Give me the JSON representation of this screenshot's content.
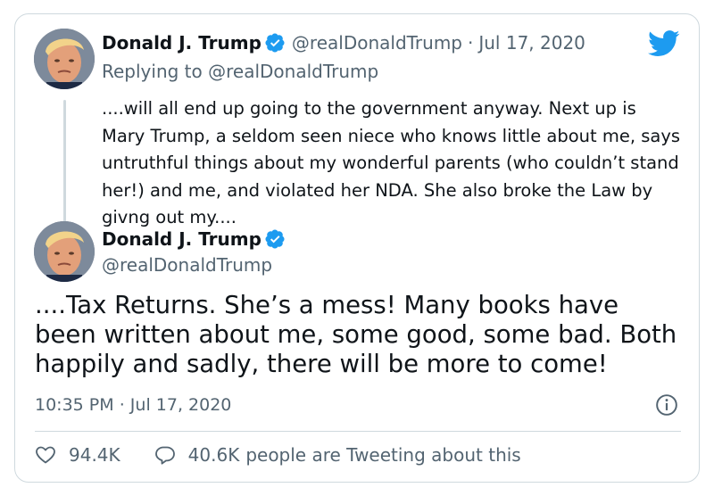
{
  "colors": {
    "brand": "#1d9bf0",
    "text_primary": "#0f1419",
    "text_secondary": "#536471",
    "border": "#cfd9de"
  },
  "parent_tweet": {
    "author_name": "Donald J. Trump",
    "verified_icon": "verified-badge-icon",
    "handle": "@realDonaldTrump",
    "separator": "·",
    "date": "Jul 17, 2020",
    "replying_to_prefix": "Replying to",
    "replying_to_handle": "@realDonaldTrump",
    "text": "....will all end up going to the government anyway. Next up is Mary Trump, a seldom seen niece who knows little about me, says untruthful things about my wonderful parents (who couldn’t stand her!) and me, and violated her NDA. She also broke the Law by givng out my...."
  },
  "main_tweet": {
    "author_name": "Donald J. Trump",
    "verified_icon": "verified-badge-icon",
    "handle": "@realDonaldTrump",
    "text": "....Tax Returns. She’s a mess! Many books have been written about me, some good, some bad. Both happily and sadly, there will be more to come!",
    "time": "10:35 PM",
    "separator": "·",
    "date": "Jul 17, 2020",
    "info_icon": "info-icon"
  },
  "stats": {
    "likes_icon": "heart-icon",
    "likes": "94.4K",
    "replies_icon": "speech-bubble-icon",
    "replies_count": "40.6K",
    "replies_suffix": "people are Tweeting about this"
  },
  "brand_logo": "twitter-bird-icon"
}
